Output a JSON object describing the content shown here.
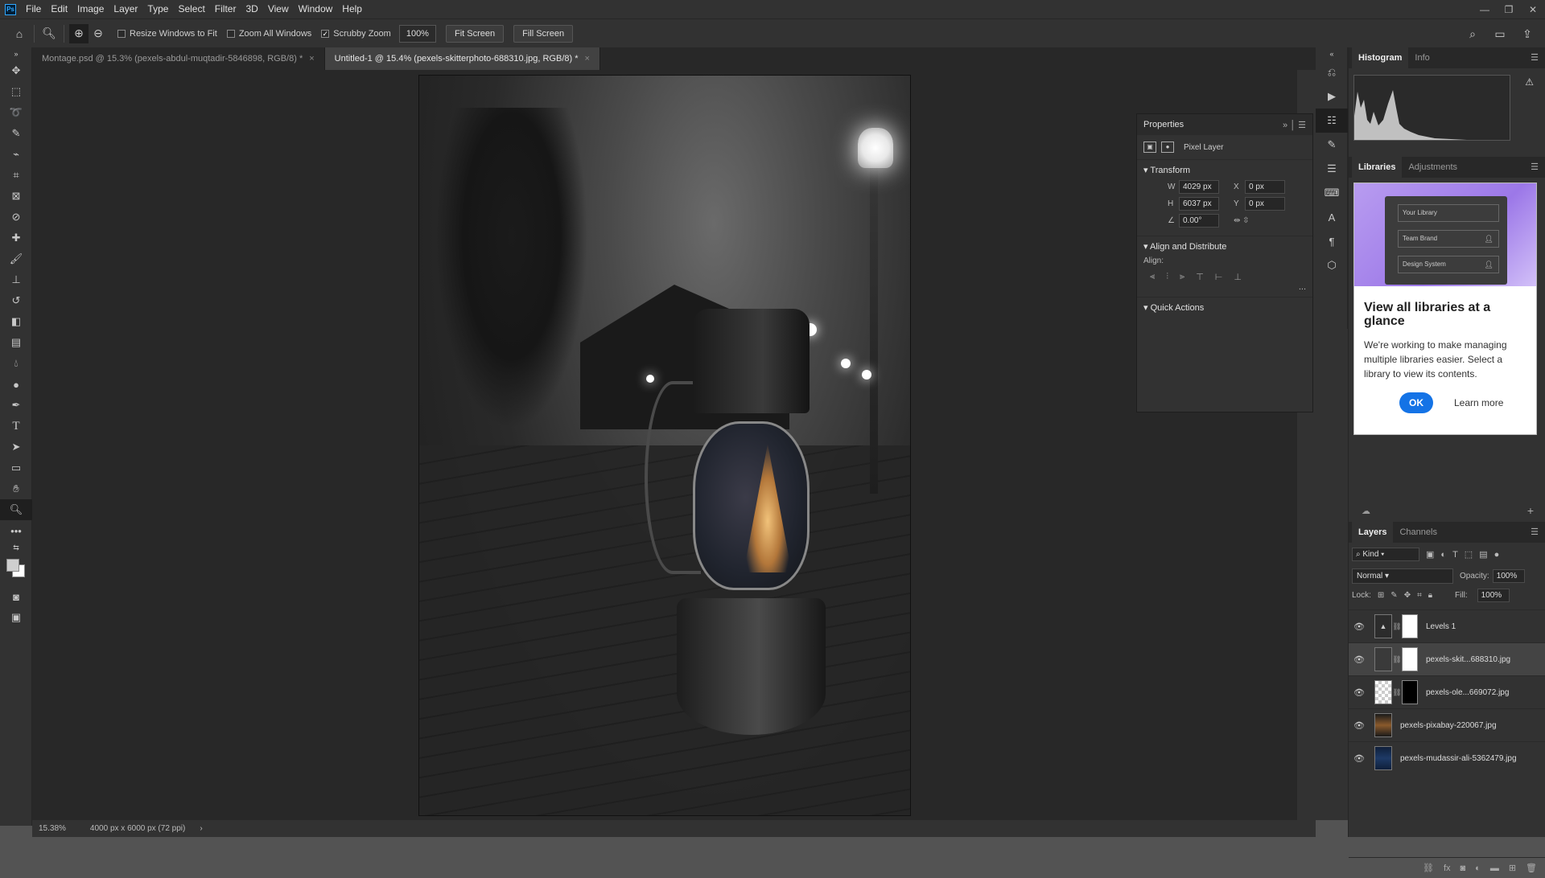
{
  "app": {
    "logo": "Ps"
  },
  "menu": [
    "File",
    "Edit",
    "Image",
    "Layer",
    "Type",
    "Select",
    "Filter",
    "3D",
    "View",
    "Window",
    "Help"
  ],
  "window_controls": {
    "minimize": "—",
    "restore": "❐",
    "close": "✕"
  },
  "options": {
    "resize_windows": "Resize Windows to Fit",
    "zoom_all_windows": "Zoom All Windows",
    "scrubby_zoom": "Scrubby Zoom",
    "scrubby_checked": "✓",
    "zoom_value": "100%",
    "fit_screen": "Fit Screen",
    "fill_screen": "Fill Screen"
  },
  "tabs": [
    {
      "label": "Montage.psd @ 15.3% (pexels-abdul-muqtadir-5846898, RGB/8) *",
      "close": "×"
    },
    {
      "label": "Untitled-1 @ 15.4% (pexels-skitterphoto-688310.jpg, RGB/8) *",
      "close": "×"
    }
  ],
  "status": {
    "zoom": "15.38%",
    "doc_size": "4000 px x 6000 px (72 ppi)",
    "arrow": "›"
  },
  "properties": {
    "title": "Properties",
    "layer_type": "Pixel Layer",
    "transform_title": "Transform",
    "w_label": "W",
    "w": "4029 px",
    "x_label": "X",
    "x": "0 px",
    "h_label": "H",
    "h": "6037 px",
    "y_label": "Y",
    "y": "0 px",
    "angle": "0.00°",
    "align_title": "Align and Distribute",
    "align_label": "Align:",
    "more": "...",
    "quick_actions": "Quick Actions"
  },
  "histogram_tabs": [
    "Histogram",
    "Info"
  ],
  "libraries_tabs": [
    "Libraries",
    "Adjustments"
  ],
  "libraries_card": {
    "mini_rows": [
      "Your Library",
      "Team Brand",
      "Design System"
    ],
    "heading": "View all libraries at a glance",
    "body": "We're working to make managing multiple libraries easier. Select a library to view its contents.",
    "ok": "OK",
    "learn_more": "Learn more"
  },
  "layers_tabs": [
    "Layers",
    "Channels"
  ],
  "layers_panel": {
    "kind": "Kind",
    "blend_mode": "Normal",
    "opacity_label": "Opacity:",
    "opacity": "100%",
    "lock_label": "Lock:",
    "fill_label": "Fill:",
    "fill": "100%"
  },
  "layers": [
    {
      "name": "Levels 1",
      "thumb": "#2c2c2c",
      "mask": "#ffffff",
      "selected": false
    },
    {
      "name": "pexels-skit...688310.jpg",
      "thumb": "#3a3a3a",
      "mask": "#ffffff",
      "selected": true
    },
    {
      "name": "pexels-ole...669072.jpg",
      "thumb": "#cfcfcf",
      "mask": "#000000",
      "selected": false
    },
    {
      "name": "pexels-pixabay-220067.jpg",
      "thumb": "#8a5a2c",
      "mask": null,
      "selected": false
    },
    {
      "name": "pexels-mudassir-ali-5362479.jpg",
      "thumb": "#1e3a66",
      "mask": null,
      "selected": false
    }
  ]
}
